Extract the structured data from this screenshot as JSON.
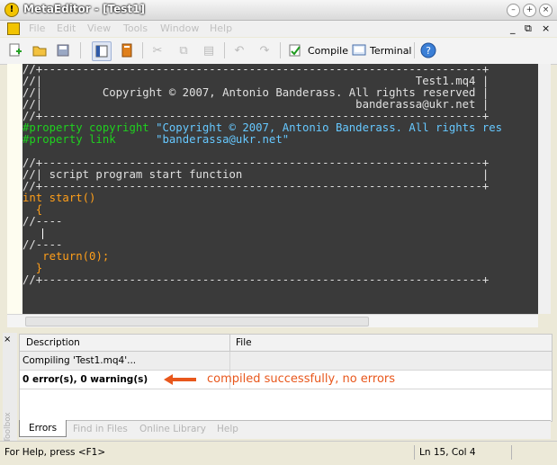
{
  "window": {
    "title": "MetaEditor - [Test1]",
    "app_icon": "!",
    "controls": [
      "–",
      "+",
      "×"
    ]
  },
  "menu": {
    "items": [
      "File",
      "Edit",
      "View",
      "Tools",
      "Window",
      "Help"
    ],
    "mdi_controls": [
      "_",
      "⧉",
      "×"
    ]
  },
  "toolbar": {
    "compile_label": "Compile",
    "terminal_label": "Terminal"
  },
  "editor": {
    "lines": [
      "//+------------------------------------------------------------------+",
      "//|                                                        Test1.mq4 |",
      "//|         Copyright © 2007, Antonio Banderass. All rights reserved |",
      "//|                                               banderassa@ukr.net |",
      "//+------------------------------------------------------------------+",
      "#property copyright \"Copyright © 2007, Antonio Banderass. All rights res",
      "#property link      \"banderassa@ukr.net\"",
      "",
      "//+------------------------------------------------------------------+",
      "//| script program start function                                    |",
      "//+------------------------------------------------------------------+",
      "int start()",
      "  {",
      "//----",
      "",
      "//----",
      "   return(0);",
      "  }",
      "//+------------------------------------------------------------------+"
    ],
    "property_copyright_kw": "#property copyright",
    "property_copyright_val": "\"Copyright © 2007, Antonio Banderass. All rights res",
    "property_link_kw": "#property link",
    "property_link_val": "\"banderassa@ukr.net\"",
    "int_kw": "int",
    "start_fn": " start()",
    "return_kw": "   return",
    "return_arg": "(0);",
    "brace_open": "  {",
    "brace_close": "  }"
  },
  "output": {
    "columns": [
      "Description",
      "File"
    ],
    "rows": [
      {
        "description": "Compiling 'Test1.mq4'...",
        "file": ""
      },
      {
        "description": "0 error(s), 0 warning(s)",
        "file": ""
      }
    ],
    "annotation": "compiled successfully, no errors"
  },
  "toolbox": {
    "label": "Toolbox",
    "close": "×",
    "tabs": [
      "Errors",
      "Find in Files",
      "Online Library",
      "Help"
    ]
  },
  "status": {
    "help_text": "For Help, press <F1>",
    "position": "Ln 15, Col 4"
  },
  "colors": {
    "editor_bg": "#3a3a3a",
    "comment": "#e0e0e0",
    "property": "#1fd11f",
    "string": "#66c8ff",
    "keyword": "#ff9f1a",
    "annotation": "#e8571c"
  }
}
